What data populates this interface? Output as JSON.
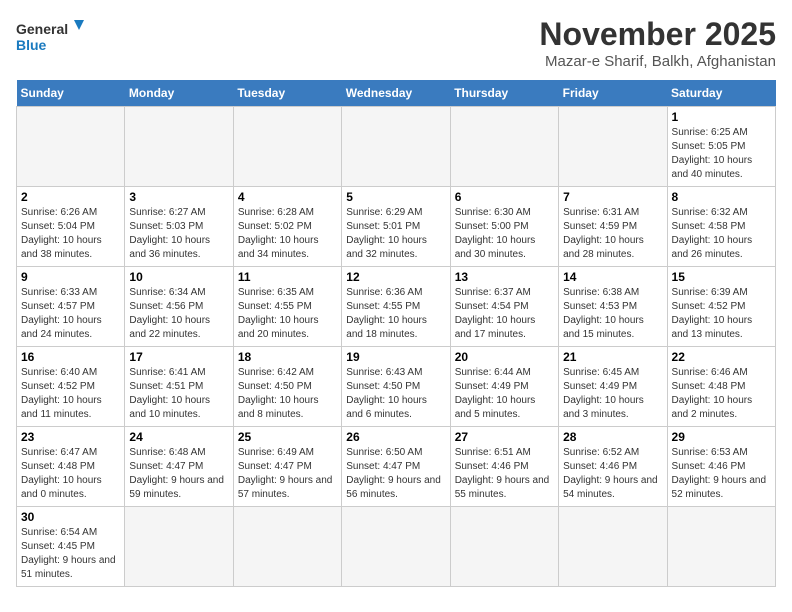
{
  "header": {
    "logo_line1": "General",
    "logo_line2": "Blue",
    "month": "November 2025",
    "location": "Mazar-e Sharif, Balkh, Afghanistan"
  },
  "weekdays": [
    "Sunday",
    "Monday",
    "Tuesday",
    "Wednesday",
    "Thursday",
    "Friday",
    "Saturday"
  ],
  "weeks": [
    [
      {
        "day": "",
        "info": ""
      },
      {
        "day": "",
        "info": ""
      },
      {
        "day": "",
        "info": ""
      },
      {
        "day": "",
        "info": ""
      },
      {
        "day": "",
        "info": ""
      },
      {
        "day": "",
        "info": ""
      },
      {
        "day": "1",
        "info": "Sunrise: 6:25 AM\nSunset: 5:05 PM\nDaylight: 10 hours and 40 minutes."
      }
    ],
    [
      {
        "day": "2",
        "info": "Sunrise: 6:26 AM\nSunset: 5:04 PM\nDaylight: 10 hours and 38 minutes."
      },
      {
        "day": "3",
        "info": "Sunrise: 6:27 AM\nSunset: 5:03 PM\nDaylight: 10 hours and 36 minutes."
      },
      {
        "day": "4",
        "info": "Sunrise: 6:28 AM\nSunset: 5:02 PM\nDaylight: 10 hours and 34 minutes."
      },
      {
        "day": "5",
        "info": "Sunrise: 6:29 AM\nSunset: 5:01 PM\nDaylight: 10 hours and 32 minutes."
      },
      {
        "day": "6",
        "info": "Sunrise: 6:30 AM\nSunset: 5:00 PM\nDaylight: 10 hours and 30 minutes."
      },
      {
        "day": "7",
        "info": "Sunrise: 6:31 AM\nSunset: 4:59 PM\nDaylight: 10 hours and 28 minutes."
      },
      {
        "day": "8",
        "info": "Sunrise: 6:32 AM\nSunset: 4:58 PM\nDaylight: 10 hours and 26 minutes."
      }
    ],
    [
      {
        "day": "9",
        "info": "Sunrise: 6:33 AM\nSunset: 4:57 PM\nDaylight: 10 hours and 24 minutes."
      },
      {
        "day": "10",
        "info": "Sunrise: 6:34 AM\nSunset: 4:56 PM\nDaylight: 10 hours and 22 minutes."
      },
      {
        "day": "11",
        "info": "Sunrise: 6:35 AM\nSunset: 4:55 PM\nDaylight: 10 hours and 20 minutes."
      },
      {
        "day": "12",
        "info": "Sunrise: 6:36 AM\nSunset: 4:55 PM\nDaylight: 10 hours and 18 minutes."
      },
      {
        "day": "13",
        "info": "Sunrise: 6:37 AM\nSunset: 4:54 PM\nDaylight: 10 hours and 17 minutes."
      },
      {
        "day": "14",
        "info": "Sunrise: 6:38 AM\nSunset: 4:53 PM\nDaylight: 10 hours and 15 minutes."
      },
      {
        "day": "15",
        "info": "Sunrise: 6:39 AM\nSunset: 4:52 PM\nDaylight: 10 hours and 13 minutes."
      }
    ],
    [
      {
        "day": "16",
        "info": "Sunrise: 6:40 AM\nSunset: 4:52 PM\nDaylight: 10 hours and 11 minutes."
      },
      {
        "day": "17",
        "info": "Sunrise: 6:41 AM\nSunset: 4:51 PM\nDaylight: 10 hours and 10 minutes."
      },
      {
        "day": "18",
        "info": "Sunrise: 6:42 AM\nSunset: 4:50 PM\nDaylight: 10 hours and 8 minutes."
      },
      {
        "day": "19",
        "info": "Sunrise: 6:43 AM\nSunset: 4:50 PM\nDaylight: 10 hours and 6 minutes."
      },
      {
        "day": "20",
        "info": "Sunrise: 6:44 AM\nSunset: 4:49 PM\nDaylight: 10 hours and 5 minutes."
      },
      {
        "day": "21",
        "info": "Sunrise: 6:45 AM\nSunset: 4:49 PM\nDaylight: 10 hours and 3 minutes."
      },
      {
        "day": "22",
        "info": "Sunrise: 6:46 AM\nSunset: 4:48 PM\nDaylight: 10 hours and 2 minutes."
      }
    ],
    [
      {
        "day": "23",
        "info": "Sunrise: 6:47 AM\nSunset: 4:48 PM\nDaylight: 10 hours and 0 minutes."
      },
      {
        "day": "24",
        "info": "Sunrise: 6:48 AM\nSunset: 4:47 PM\nDaylight: 9 hours and 59 minutes."
      },
      {
        "day": "25",
        "info": "Sunrise: 6:49 AM\nSunset: 4:47 PM\nDaylight: 9 hours and 57 minutes."
      },
      {
        "day": "26",
        "info": "Sunrise: 6:50 AM\nSunset: 4:47 PM\nDaylight: 9 hours and 56 minutes."
      },
      {
        "day": "27",
        "info": "Sunrise: 6:51 AM\nSunset: 4:46 PM\nDaylight: 9 hours and 55 minutes."
      },
      {
        "day": "28",
        "info": "Sunrise: 6:52 AM\nSunset: 4:46 PM\nDaylight: 9 hours and 54 minutes."
      },
      {
        "day": "29",
        "info": "Sunrise: 6:53 AM\nSunset: 4:46 PM\nDaylight: 9 hours and 52 minutes."
      }
    ],
    [
      {
        "day": "30",
        "info": "Sunrise: 6:54 AM\nSunset: 4:45 PM\nDaylight: 9 hours and 51 minutes."
      },
      {
        "day": "",
        "info": ""
      },
      {
        "day": "",
        "info": ""
      },
      {
        "day": "",
        "info": ""
      },
      {
        "day": "",
        "info": ""
      },
      {
        "day": "",
        "info": ""
      },
      {
        "day": "",
        "info": ""
      }
    ]
  ]
}
